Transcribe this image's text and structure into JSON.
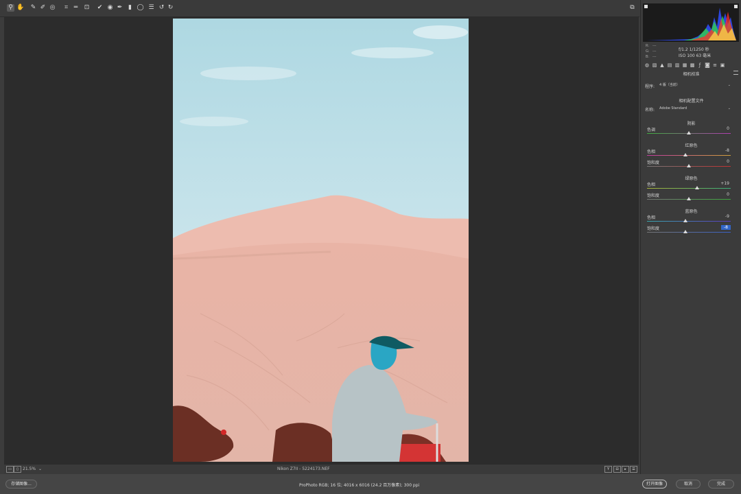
{
  "toolbar": {
    "tools": [
      {
        "name": "zoom-tool-icon",
        "glyph": "⚲"
      },
      {
        "name": "hand-tool-icon",
        "glyph": "✋"
      },
      {
        "name": "white-balance-tool-icon",
        "glyph": "✎"
      },
      {
        "name": "color-sampler-tool-icon",
        "glyph": "✐"
      },
      {
        "name": "targeted-adjustment-tool-icon",
        "glyph": "◎"
      },
      {
        "name": "crop-tool-icon",
        "glyph": "⌗"
      },
      {
        "name": "straighten-tool-icon",
        "glyph": "═"
      },
      {
        "name": "transform-tool-icon",
        "glyph": "⊡"
      },
      {
        "name": "spot-removal-tool-icon",
        "glyph": "✔"
      },
      {
        "name": "red-eye-tool-icon",
        "glyph": "◉"
      },
      {
        "name": "adjustment-brush-icon",
        "glyph": "✒"
      },
      {
        "name": "graduated-filter-icon",
        "glyph": "▮"
      },
      {
        "name": "radial-filter-icon",
        "glyph": "◯"
      },
      {
        "name": "preferences-icon",
        "glyph": "☰"
      },
      {
        "name": "rotate-left-icon",
        "glyph": "↺"
      },
      {
        "name": "rotate-right-icon",
        "glyph": "↻"
      }
    ],
    "fullscreen_glyph": "⧉"
  },
  "histogram": {
    "rgb_labels": [
      "R:",
      "G:",
      "B:"
    ],
    "rgb_values": [
      "---",
      "---",
      "---"
    ],
    "exif_line1": "f/1.2   1/1250 秒",
    "exif_line2": "ISO 100   63 毫米"
  },
  "panel": {
    "section_title": "相机校准",
    "process_label": "程序:",
    "process_value": "4 版（当前）",
    "camera_profile_title": "相机配置文件",
    "name_label": "名称:",
    "name_value": "Adobe Standard",
    "shadows_title": "阴影",
    "red_primary_title": "红原色",
    "green_primary_title": "绿原色",
    "blue_primary_title": "蓝原色",
    "sliders": [
      {
        "label": "色调",
        "value": "0",
        "level": 0.5,
        "colors": [
          "#3fae3f",
          "#b23cb2"
        ]
      },
      {
        "label": "色相",
        "value": "-8",
        "level": 0.46,
        "colors": [
          "#c23ca0",
          "#d2a23c"
        ]
      },
      {
        "label": "饱和度",
        "value": "0",
        "level": 0.5,
        "colors": [
          "#777777",
          "#c23232"
        ]
      },
      {
        "label": "色相",
        "value": "+19",
        "level": 0.595,
        "colors": [
          "#a8b43a",
          "#3ab07a"
        ]
      },
      {
        "label": "饱和度",
        "value": "0",
        "level": 0.5,
        "colors": [
          "#777777",
          "#3eaa3e"
        ]
      },
      {
        "label": "色相",
        "value": "-9",
        "level": 0.455,
        "colors": [
          "#3aa8b0",
          "#5a3ac0"
        ]
      },
      {
        "label": "饱和度",
        "value": "-8",
        "level": 0.46,
        "colors": [
          "#777777",
          "#3a62c8"
        ]
      }
    ]
  },
  "statusbar": {
    "zoom_value": "21.5%",
    "filename": "Nikon Z7II - 5224173.NEF",
    "view_buttons": [
      "Y",
      "⊟",
      "▸",
      "☰"
    ]
  },
  "bottom": {
    "save_label": "存储图像...",
    "workflow_info": "ProPhoto RGB; 16 位; 4016 x 6016 (24.2 百万像素); 300 ppi",
    "open_label": "打开图像",
    "cancel_label": "取消",
    "done_label": "完成"
  }
}
